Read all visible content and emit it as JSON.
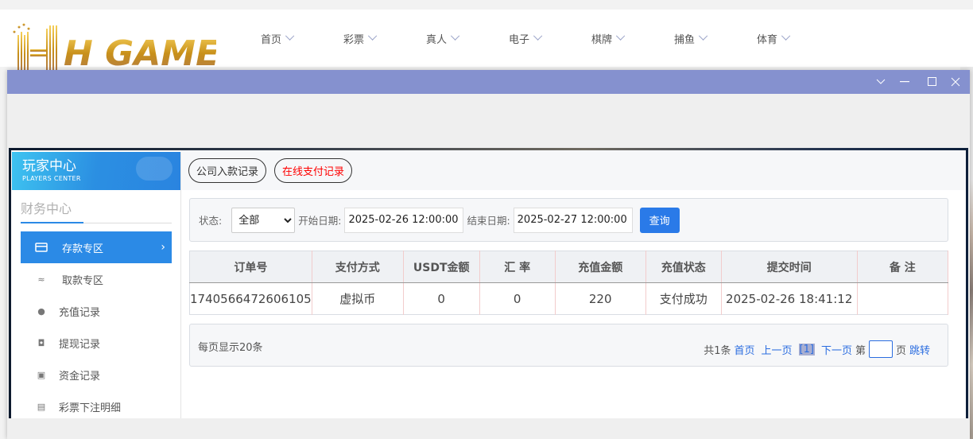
{
  "logo": {
    "text": "HH GAME"
  },
  "nav": [
    {
      "label": "首页"
    },
    {
      "label": "彩票"
    },
    {
      "label": "真人"
    },
    {
      "label": "电子"
    },
    {
      "label": "棋牌"
    },
    {
      "label": "捕鱼"
    },
    {
      "label": "体育"
    }
  ],
  "window": {
    "controls": [
      "chevron-down",
      "minimize",
      "maximize",
      "close"
    ],
    "titlebar_color": "#8591cf"
  },
  "sidebar": {
    "title": "玩家中心",
    "subtitle": "PLAYERS CENTER",
    "section": "财务中心",
    "items": [
      {
        "label": "存款专区",
        "icon": "card-icon",
        "active": true
      },
      {
        "label": "取款专区",
        "icon": "hand-money-icon"
      },
      {
        "label": "充值记录",
        "icon": "money-bag-icon"
      },
      {
        "label": "提现记录",
        "icon": "wallet-icon"
      },
      {
        "label": "资金记录",
        "icon": "funds-icon"
      },
      {
        "label": "彩票下注明细",
        "icon": "list-icon"
      }
    ]
  },
  "tabs": [
    {
      "label": "公司入款记录",
      "color": "#333333"
    },
    {
      "label": "在线支付记录",
      "color": "#ff0000"
    }
  ],
  "filter": {
    "status_label": "状态:",
    "status_value": "全部",
    "start_label": "开始日期:",
    "start_value": "2025-02-26 12:00:00",
    "end_label": "结束日期:",
    "end_value": "2025-02-27 12:00:00",
    "query_label": "查询"
  },
  "table": {
    "headers": [
      "订单号",
      "支付方式",
      "USDT金额",
      "汇 率",
      "充值金额",
      "充值状态",
      "提交时间",
      "备 注"
    ],
    "rows": [
      [
        "1740566472606105",
        "虚拟币",
        "0",
        "0",
        "220",
        "支付成功",
        "2025-02-26 18:41:12",
        ""
      ]
    ]
  },
  "pager": {
    "per_page": "每页显示20条",
    "total": "共1条",
    "first": "首页",
    "prev": "上一页",
    "current": "[1]",
    "next": "下一页",
    "goto_prefix": "第",
    "goto_suffix": "页",
    "jump": "跳转"
  }
}
